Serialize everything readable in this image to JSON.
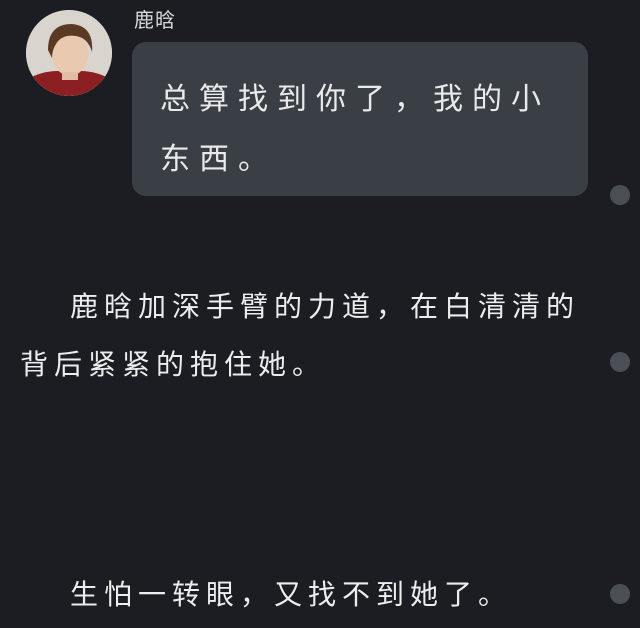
{
  "message": {
    "sender_name": "鹿晗",
    "text": "总算找到你了，我的小东西。"
  },
  "story": {
    "paragraph_1": "鹿晗加深手臂的力道，在白清清的背后紧紧的抱住她。",
    "paragraph_2": "生怕一转眼，又找不到她了。"
  },
  "colors": {
    "background": "#1b1d22",
    "bubble": "#3a3f46",
    "text": "#ededed",
    "comment_dot": "#4a4e55"
  },
  "icons": {
    "avatar": "user-avatar-photo",
    "comment_dot": "paragraph-comment-dot"
  }
}
